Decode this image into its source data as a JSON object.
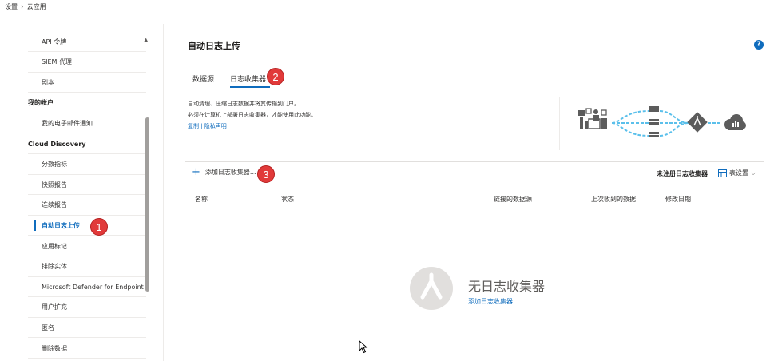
{
  "breadcrumb": {
    "items": [
      "设置",
      "云应用"
    ]
  },
  "sidebar": {
    "items": [
      {
        "label": "API 令牌"
      },
      {
        "label": "SIEM 代理"
      },
      {
        "label": "剧本"
      },
      {
        "label": "我的帐户",
        "section": true
      },
      {
        "label": "我的电子邮件通知"
      },
      {
        "label": "Cloud Discovery",
        "section": true
      },
      {
        "label": "分数指标"
      },
      {
        "label": "快照报告"
      },
      {
        "label": "连续报告"
      },
      {
        "label": "自动日志上传",
        "active": true
      },
      {
        "label": "应用标记"
      },
      {
        "label": "排除实体"
      },
      {
        "label": "Microsoft Defender for Endpoint"
      },
      {
        "label": "用户扩充"
      },
      {
        "label": "匿名"
      },
      {
        "label": "删除数据"
      }
    ]
  },
  "header": {
    "title": "自动日志上传",
    "help": "?"
  },
  "tabs": [
    {
      "label": "数据源"
    },
    {
      "label": "日志收集器",
      "selected": true
    }
  ],
  "badges": [
    "1",
    "2",
    "3"
  ],
  "description": {
    "line1": "自动清理、压缩日志数据并将其传输到门户。",
    "line2": "必须在计算机上部署日志收集器，才能使用此功能。",
    "links": "复制 | 隐私声明"
  },
  "toolbar": {
    "add_label": "添加日志收集器...",
    "unconnected_label": "未注册日志收集器",
    "table_settings_label": "表设置"
  },
  "table": {
    "columns": [
      "名称",
      "状态",
      "链接的数据源",
      "上次收到的数据",
      "修改日期"
    ]
  },
  "empty_state": {
    "title": "无日志收集器",
    "link": "添加日志收集器..."
  },
  "colors": {
    "accent": "#0f6cbd",
    "badge": "#e13a3a",
    "illustration_dark": "#5c5c5c",
    "illustration_flow": "#5bc0eb"
  }
}
